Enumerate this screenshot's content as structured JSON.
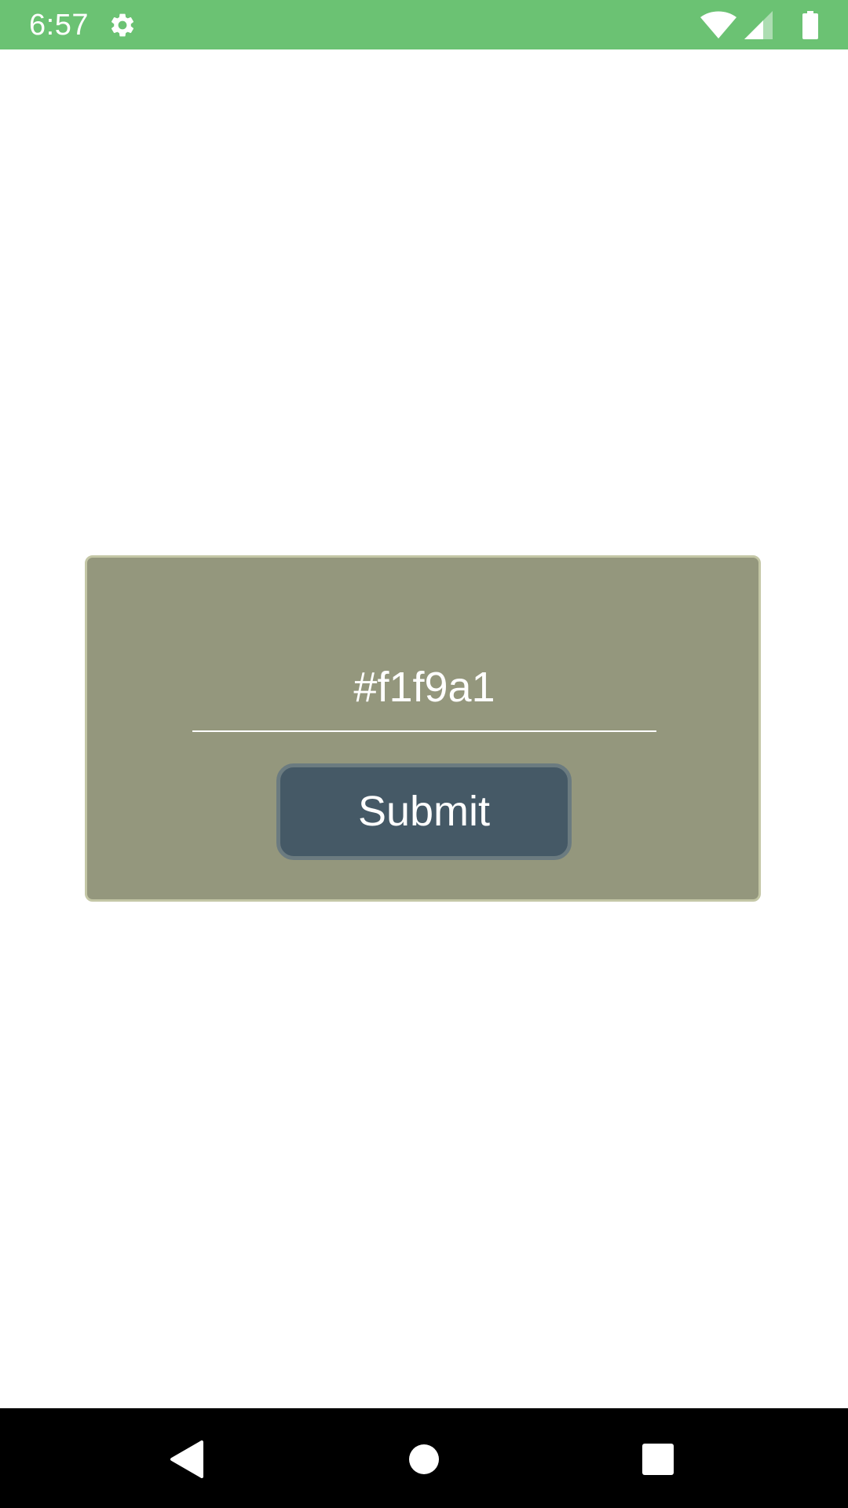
{
  "status_bar": {
    "time": "6:57",
    "icons": [
      "gear-icon",
      "wifi-icon",
      "signal-icon",
      "battery-icon"
    ],
    "background_color": "#6bc273"
  },
  "form": {
    "card_color": "#94977d",
    "hex_value": "#f1f9a1",
    "submit_label": "Submit",
    "button_color": "#455966"
  },
  "nav_bar": {
    "buttons": [
      "back-icon",
      "home-icon",
      "recents-icon"
    ]
  }
}
